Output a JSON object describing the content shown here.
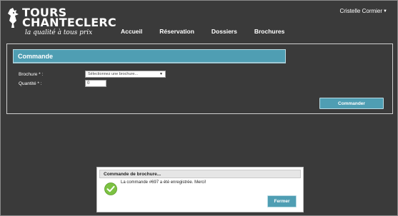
{
  "header": {
    "brand_line1": "TOURS",
    "brand_line2": "CHANTECLERC",
    "tagline": "la qualité à tous prix",
    "user_name": "Cristelle Cormier",
    "nav": [
      "Accueil",
      "Réservation",
      "Dossiers",
      "Brochures"
    ]
  },
  "order_panel": {
    "title": "Commande",
    "brochure_label": "Brochure * :",
    "brochure_select": "Sélectionnez une brochure...",
    "quantity_label": "Quantité * :",
    "quantity_value": "0",
    "submit_label": "Commander"
  },
  "dialog": {
    "title": "Commande de brochure...",
    "message": "La commande #697 a été enregistrée. Merci!",
    "close_label": "Fermer"
  },
  "colors": {
    "background": "#3a3a3a",
    "accent": "#4f9eb3",
    "success": "#7cc242"
  }
}
